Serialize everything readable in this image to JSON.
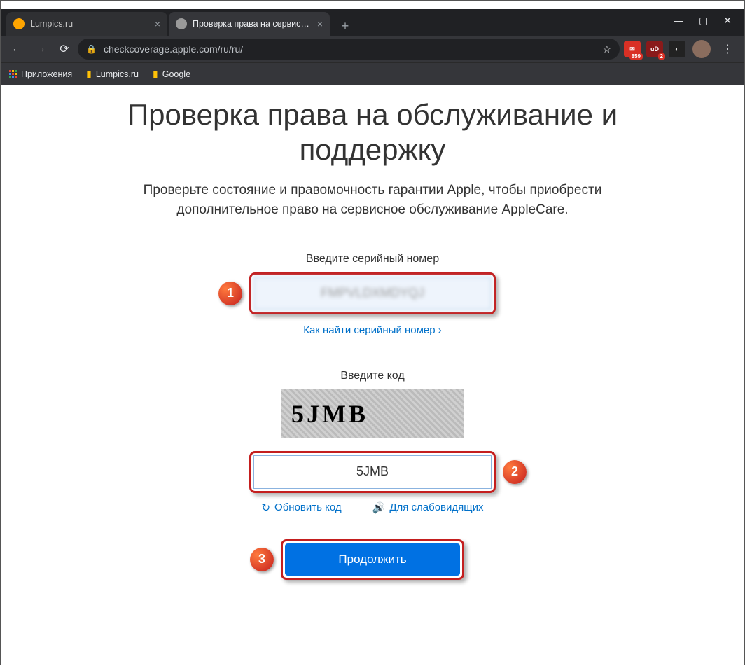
{
  "window": {
    "tabs": [
      {
        "title": "Lumpics.ru",
        "favicon_color": "#ffa500",
        "active": false
      },
      {
        "title": "Проверка права на сервисное о",
        "favicon_color": "#9a9a9a",
        "active": true
      }
    ],
    "url": "checkcoverage.apple.com/ru/ru/"
  },
  "extensions": [
    {
      "bg": "#d93025",
      "label": "",
      "badge": "859"
    },
    {
      "bg": "#8a1a1a",
      "label": "uD",
      "badge": "2"
    },
    {
      "bg": "#222",
      "label": "◐",
      "badge": ""
    }
  ],
  "bookmarks": {
    "apps": "Приложения",
    "items": [
      {
        "label": "Lumpics.ru"
      },
      {
        "label": "Google"
      }
    ]
  },
  "page": {
    "heading": "Проверка права на обслуживание и поддержку",
    "subtitle": "Проверьте состояние и правомочность гарантии Apple, чтобы приобрести дополнительное право на сервисное обслуживание AppleCare.",
    "serial_label": "Введите серийный номер",
    "serial_value": "FMPVLDXMDYQJ",
    "serial_help": "Как найти серийный номер ›",
    "code_label": "Введите код",
    "captcha_text": "5JMB",
    "code_value": "5JMB",
    "refresh_label": "Обновить код",
    "audio_label": "Для слабовидящих",
    "continue_label": "Продолжить"
  },
  "annotations": {
    "m1": "1",
    "m2": "2",
    "m3": "3"
  }
}
